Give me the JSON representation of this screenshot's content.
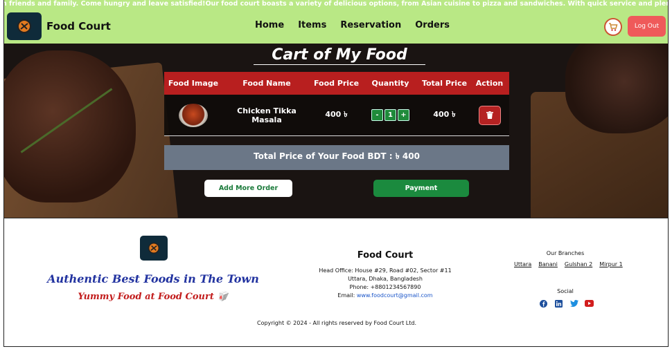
{
  "marquee": {
    "text": "h friends and family. Come hungry and leave satisfied!Our food court boasts a variety of delicious options, from Asian cuisine to pizza and sandwiches. With quick service and plenty of seating, it is the perfect spo"
  },
  "nav": {
    "brand": "Food Court",
    "links": [
      "Home",
      "Items",
      "Reservation",
      "Orders"
    ],
    "logout": "Log Out",
    "cart_icon": "cart-icon"
  },
  "cart": {
    "title": "Cart of My Food",
    "headers": [
      "Food Image",
      "Food Name",
      "Food Price",
      "Quantity",
      "Total Price",
      "Action"
    ],
    "rows": [
      {
        "name": "Chicken Tikka Masala",
        "price": "400 ৳",
        "quantity": "1",
        "total": "400 ৳"
      }
    ],
    "qty_minus": "-",
    "qty_plus": "+",
    "total_text": "Total Price of Your Food BDT : ৳ 400",
    "add_more": "Add More Order",
    "payment": "Payment"
  },
  "footer": {
    "tagline": "Authentic Best Foods in The Town",
    "subtag": "Yummy Food at Food Court",
    "company": "Food Court",
    "head_office": "Head Office: House #29, Road #02, Sector #11",
    "city": "Uttara, Dhaka, Bangladesh",
    "phone": "Phone: +8801234567890",
    "email_label": "Email:",
    "email": "www.foodcourt@gmail.com",
    "branches_title": "Our Branches",
    "branches": [
      "Uttara",
      "Banani",
      "Gulshan 2",
      "Mirpur 1"
    ],
    "social_title": "Social",
    "copyright": "Copyright © 2024 - All rights reserved by Food Court Ltd."
  },
  "colors": {
    "nav_bg": "#b9e885",
    "header_red": "#b81f1f",
    "payment_green": "#1b8a3e",
    "logout_red": "#ef5a5a",
    "total_bar": "#6b7787"
  }
}
